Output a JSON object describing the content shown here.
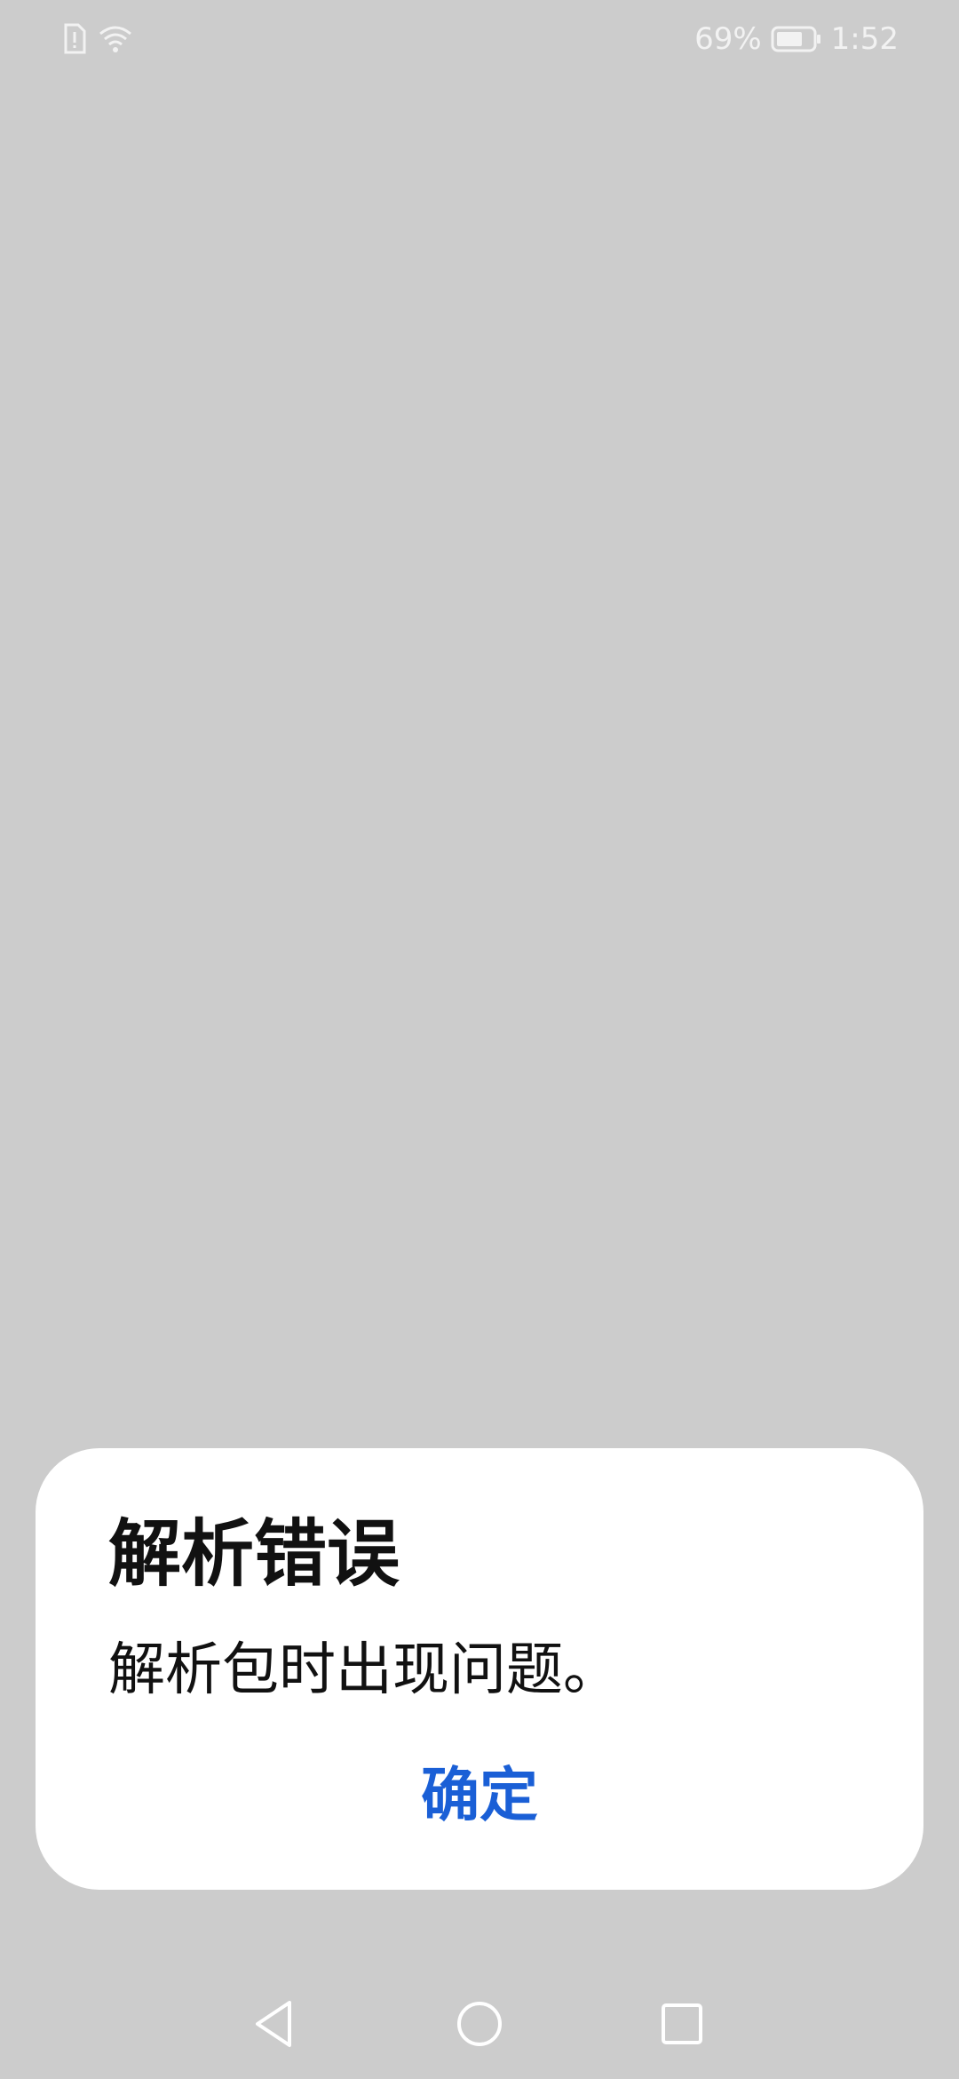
{
  "status_bar": {
    "battery_percent": "69%",
    "time": "1:52",
    "icons": [
      "sim-alert-icon",
      "wifi-icon",
      "battery-icon"
    ]
  },
  "dialog": {
    "title": "解析错误",
    "message": "解析包时出现问题。",
    "confirm_label": "确定"
  },
  "nav_bar": {
    "icons": [
      "back-icon",
      "home-icon",
      "recents-icon"
    ]
  },
  "colors": {
    "scrim": "#cccccc",
    "dialog_bg": "#ffffff",
    "accent": "#1a5fd6",
    "status_text": "#f2f2f2"
  }
}
